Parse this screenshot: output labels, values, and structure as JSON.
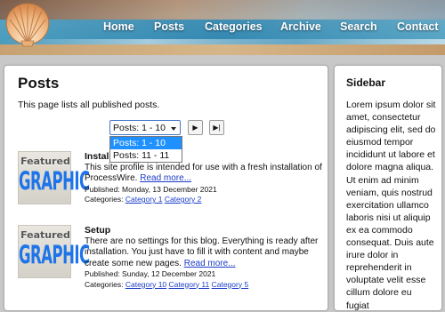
{
  "header": {
    "logo_icon": "seashell-icon",
    "nav": [
      {
        "label": "Home"
      },
      {
        "label": "Posts"
      },
      {
        "label": "Categories"
      },
      {
        "label": "Archive"
      },
      {
        "label": "Search"
      },
      {
        "label": "Contact"
      }
    ]
  },
  "main": {
    "title": "Posts",
    "intro": "This page lists all published posts.",
    "pager": {
      "selected": "Posts: 1 - 10",
      "options": [
        "Posts: 1 - 10",
        "Posts: 11 - 11"
      ],
      "next_icon": "play-icon",
      "last_icon": "skip-to-end-icon"
    },
    "posts": [
      {
        "thumb_line1": "Featured",
        "thumb_line2": "GRAPHIC",
        "title": "Installation",
        "excerpt": "This site profile is intended for use with a fresh installation of ProcessWire.",
        "read_more": "Read more...",
        "published": "Published: Monday, 13 December 2021",
        "categories_label": "Categories:",
        "categories": [
          "Category 1",
          "Category 2"
        ]
      },
      {
        "thumb_line1": "Featured",
        "thumb_line2": "GRAPHIC",
        "title": "Setup",
        "excerpt": "There are no settings for this blog. Everything is ready after installation. You just have to fill it with content and maybe create some new pages.",
        "read_more": "Read more...",
        "published": "Published: Sunday, 12 December 2021",
        "categories_label": "Categories:",
        "categories": [
          "Category 10",
          "Category 11",
          "Category 5"
        ]
      }
    ]
  },
  "sidebar": {
    "title": "Sidebar",
    "text": "Lorem ipsum dolor sit amet, consectetur adipiscing elit, sed do eiusmod tempor incididunt ut labore et dolore magna aliqua. Ut enim ad minim veniam, quis nostrud exercitation ullamco laboris nisi ut aliquip ex ea commodo consequat. Duis aute irure dolor in reprehenderit in voluptate velit esse cillum dolore eu fugiat"
  },
  "colors": {
    "link": "#1a3cc8",
    "dropdown_selected": "#1e90ff",
    "thumb_graphic": "#1e74e8"
  }
}
